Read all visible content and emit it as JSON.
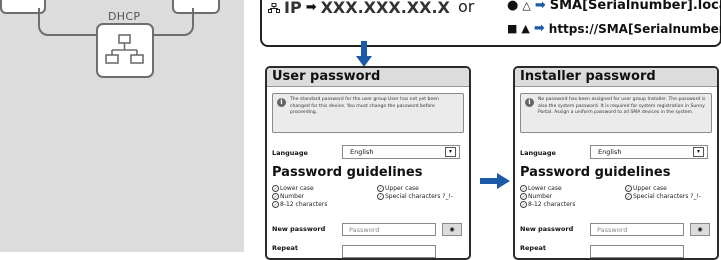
{
  "dhcp_label": "DHCP",
  "url_box": {
    "ip_prefix": "IP",
    "ip_value": "XXX.XXX.XX.X",
    "or_word": "or",
    "mac_url": "SMA[Serialnumber].local",
    "win_url": "https://SMA[Serialnumber]"
  },
  "user_panel": {
    "title": "User password",
    "info": "The standard password for the user group User has not yet been changed for this device. You must change the password before proceeding.",
    "language_label": "Language",
    "language_value": "English",
    "guidelines_title": "Password guidelines",
    "rules": [
      "Lower case",
      "Upper case",
      "Number",
      "Special characters ?_!-",
      "8-12 characters"
    ],
    "new_password_label": "New password",
    "new_password_placeholder": "Password",
    "repeat_label": "Repeat"
  },
  "installer_panel": {
    "title": "Installer password",
    "info": "No password has been assigned for user group Installer. The password is also the system password. It is required for system registration in Sunny Portal. Assign a uniform password to all SMA devices in the system.",
    "language_label": "Language",
    "language_value": "English",
    "guidelines_title": "Password guidelines",
    "rules": [
      "Lower case",
      "Upper case",
      "Number",
      "Special characters ?_!-",
      "8-12 characters"
    ],
    "new_password_label": "New password",
    "new_password_placeholder": "Password",
    "repeat_label": "Repeat"
  },
  "colors": {
    "arrow": "#1a5aa6",
    "panel_header": "#dcdcdc",
    "left_bg": "#dcdcdc"
  },
  "icons": [
    "network-icon",
    "apple-icon",
    "linux-icon",
    "windows-icon",
    "android-icon",
    "info-icon",
    "eye-icon",
    "chevron-down-icon"
  ]
}
